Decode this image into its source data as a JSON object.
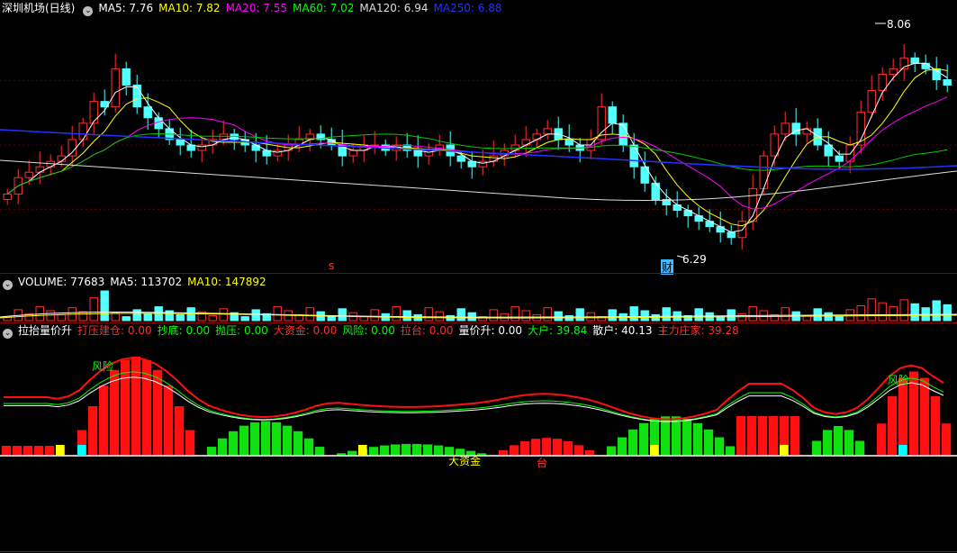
{
  "panel1": {
    "title": "深圳机场(日线)",
    "indicators": [
      {
        "label": "MA5: 7.76",
        "color": "#ffffff"
      },
      {
        "label": "MA10: 7.82",
        "color": "#ffff00"
      },
      {
        "label": "MA20: 7.55",
        "color": "#ff00ff"
      },
      {
        "label": "MA60: 7.02",
        "color": "#00ff00"
      },
      {
        "label": "MA120: 6.94",
        "color": "#dddddd"
      },
      {
        "label": "MA250: 6.88",
        "color": "#2233ff"
      }
    ],
    "high_label": "8.06",
    "low_label": "6.29",
    "marker_s": "s",
    "marker_cai": "财"
  },
  "panel2": {
    "indicators": [
      {
        "label": "VOLUME: 77683",
        "color": "#ffffff"
      },
      {
        "label": "MA5: 113702",
        "color": "#ffffff"
      },
      {
        "label": "MA10: 147892",
        "color": "#ffff00"
      }
    ]
  },
  "panel3": {
    "indicators": [
      {
        "label": "拉抬量价升",
        "color": "#ffffff"
      },
      {
        "label": "打压建仓: 0.00",
        "color": "#ff3030"
      },
      {
        "label": "抄底: 0.00",
        "color": "#00ff00"
      },
      {
        "label": "抛压: 0.00",
        "color": "#00ff00"
      },
      {
        "label": "大资金: 0.00",
        "color": "#ff3030"
      },
      {
        "label": "风险: 0.00",
        "color": "#00ff00"
      },
      {
        "label": "拉台: 0.00",
        "color": "#ff3030"
      },
      {
        "label": "量价升: 0.00",
        "color": "#ffffff"
      },
      {
        "label": "大户: 39.84",
        "color": "#00ff00"
      },
      {
        "label": "散户: 40.13",
        "color": "#ffffff"
      },
      {
        "label": "主力庄家: 39.28",
        "color": "#ff3030"
      }
    ],
    "risk_label": "风险",
    "big_fund_label": "大资金",
    "lift_label": "台"
  },
  "chart_data": {
    "type": "candlestick",
    "price_range": [
      6.1,
      8.3
    ],
    "high": 8.06,
    "low": 6.29,
    "close": [
      6.75,
      6.9,
      6.95,
      7.0,
      7.05,
      7.1,
      7.25,
      7.4,
      7.6,
      7.55,
      7.9,
      7.75,
      7.55,
      7.45,
      7.35,
      7.25,
      7.2,
      7.15,
      7.2,
      7.25,
      7.3,
      7.25,
      7.2,
      7.15,
      7.1,
      7.15,
      7.2,
      7.25,
      7.3,
      7.25,
      7.2,
      7.1,
      7.15,
      7.2,
      7.2,
      7.15,
      7.2,
      7.15,
      7.1,
      7.15,
      7.2,
      7.1,
      7.05,
      7.0,
      7.05,
      7.1,
      7.15,
      7.2,
      7.25,
      7.3,
      7.35,
      7.25,
      7.2,
      7.15,
      7.25,
      7.55,
      7.4,
      7.2,
      7.0,
      6.85,
      6.7,
      6.65,
      6.6,
      6.55,
      6.5,
      6.45,
      6.4,
      6.35,
      6.5,
      6.8,
      7.1,
      7.3,
      7.4,
      7.3,
      7.35,
      7.2,
      7.1,
      7.05,
      7.2,
      7.5,
      7.7,
      7.85,
      7.9,
      8.0,
      7.95,
      7.9,
      7.8,
      7.75
    ]
  }
}
